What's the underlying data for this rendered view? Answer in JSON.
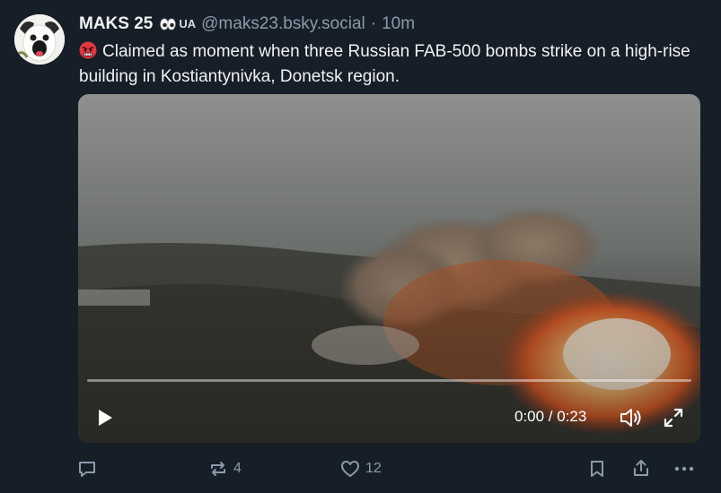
{
  "author": {
    "display_name": "MAKS 25",
    "badge_text": "UA",
    "handle": "@maks23.bsky.social",
    "separator": "·",
    "time": "10m"
  },
  "post": {
    "emoji_icon": "angry-face-icon",
    "text": "Claimed as moment when three Russian FAB-500 bombs strike on a high-rise building in Kostiantynivka, Donetsk region."
  },
  "video": {
    "time_display": "0:00 / 0:23",
    "progress": 0
  },
  "actions": {
    "reply_count": "",
    "repost_count": "4",
    "like_count": "12"
  },
  "colors": {
    "background": "#161e27",
    "text": "#f1f3f5",
    "muted": "#8d9aab"
  }
}
